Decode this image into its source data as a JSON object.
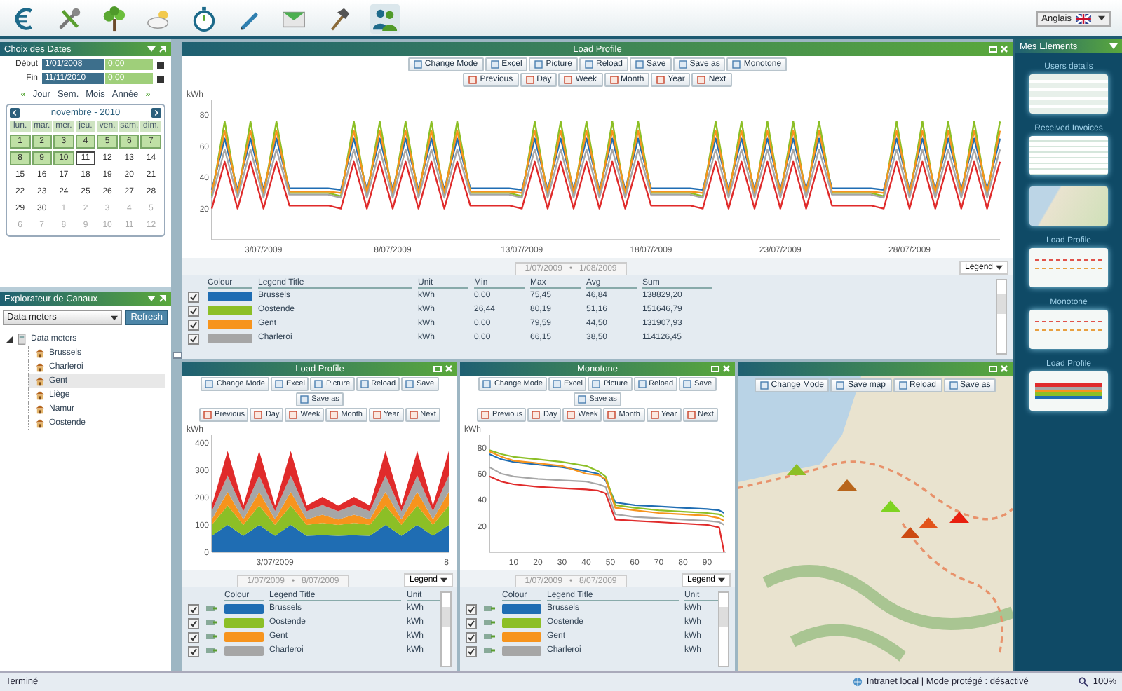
{
  "top_bar": {
    "nav_icons": [
      {
        "kind": "euro"
      },
      {
        "kind": "tools"
      },
      {
        "kind": "tree"
      },
      {
        "kind": "weather"
      },
      {
        "kind": "stopwatch"
      },
      {
        "kind": "pencil"
      },
      {
        "kind": "envelope"
      },
      {
        "kind": "hammer"
      },
      {
        "kind": "users"
      }
    ],
    "language": "Anglais"
  },
  "date_panel": {
    "title": "Choix des Dates",
    "start_label": "Début",
    "start_date": "1/01/2008",
    "start_time": "0:00",
    "end_label": "Fin",
    "end_date": "11/11/2010",
    "end_time": "0:00",
    "prev": "«",
    "next": "»",
    "modes": [
      "Jour",
      "Sem.",
      "Mois",
      "Année"
    ],
    "calendar": {
      "title": "novembre - 2010",
      "weekdays": [
        "lun.",
        "mar.",
        "mer.",
        "jeu.",
        "ven.",
        "sam.",
        "dim."
      ],
      "days": [
        {
          "label": "1",
          "selected": true,
          "today": false,
          "outside": false
        },
        {
          "label": "2",
          "selected": true,
          "today": false,
          "outside": false
        },
        {
          "label": "3",
          "selected": true,
          "today": false,
          "outside": false
        },
        {
          "label": "4",
          "selected": true,
          "today": false,
          "outside": false
        },
        {
          "label": "5",
          "selected": true,
          "today": false,
          "outside": false
        },
        {
          "label": "6",
          "selected": true,
          "today": false,
          "outside": false
        },
        {
          "label": "7",
          "selected": true,
          "today": false,
          "outside": false
        },
        {
          "label": "8",
          "selected": true,
          "today": false,
          "outside": false
        },
        {
          "label": "9",
          "selected": true,
          "today": false,
          "outside": false
        },
        {
          "label": "10",
          "selected": true,
          "today": false,
          "outside": false
        },
        {
          "label": "11",
          "selected": false,
          "today": true,
          "outside": false
        },
        {
          "label": "12",
          "selected": false,
          "today": false,
          "outside": false
        },
        {
          "label": "13",
          "selected": false,
          "today": false,
          "outside": false
        },
        {
          "label": "14",
          "selected": false,
          "today": false,
          "outside": false
        },
        {
          "label": "15",
          "selected": false,
          "today": false,
          "outside": false
        },
        {
          "label": "16",
          "selected": false,
          "today": false,
          "outside": false
        },
        {
          "label": "17",
          "selected": false,
          "today": false,
          "outside": false
        },
        {
          "label": "18",
          "selected": false,
          "today": false,
          "outside": false
        },
        {
          "label": "19",
          "selected": false,
          "today": false,
          "outside": false
        },
        {
          "label": "20",
          "selected": false,
          "today": false,
          "outside": false
        },
        {
          "label": "21",
          "selected": false,
          "today": false,
          "outside": false
        },
        {
          "label": "22",
          "selected": false,
          "today": false,
          "outside": false
        },
        {
          "label": "23",
          "selected": false,
          "today": false,
          "outside": false
        },
        {
          "label": "24",
          "selected": false,
          "today": false,
          "outside": false
        },
        {
          "label": "25",
          "selected": false,
          "today": false,
          "outside": false
        },
        {
          "label": "26",
          "selected": false,
          "today": false,
          "outside": false
        },
        {
          "label": "27",
          "selected": false,
          "today": false,
          "outside": false
        },
        {
          "label": "28",
          "selected": false,
          "today": false,
          "outside": false
        },
        {
          "label": "29",
          "selected": false,
          "today": false,
          "outside": false
        },
        {
          "label": "30",
          "selected": false,
          "today": false,
          "outside": false
        },
        {
          "label": "1",
          "selected": false,
          "today": false,
          "outside": true
        },
        {
          "label": "2",
          "selected": false,
          "today": false,
          "outside": true
        },
        {
          "label": "3",
          "selected": false,
          "today": false,
          "outside": true
        },
        {
          "label": "4",
          "selected": false,
          "today": false,
          "outside": true
        },
        {
          "label": "5",
          "selected": false,
          "today": false,
          "outside": true
        },
        {
          "label": "6",
          "selected": false,
          "today": false,
          "outside": true
        },
        {
          "label": "7",
          "selected": false,
          "today": false,
          "outside": true
        },
        {
          "label": "8",
          "selected": false,
          "today": false,
          "outside": true
        },
        {
          "label": "9",
          "selected": false,
          "today": false,
          "outside": true
        },
        {
          "label": "10",
          "selected": false,
          "today": false,
          "outside": true
        },
        {
          "label": "11",
          "selected": false,
          "today": false,
          "outside": true
        },
        {
          "label": "12",
          "selected": false,
          "today": false,
          "outside": true
        }
      ]
    }
  },
  "explorer": {
    "title": "Explorateur de Canaux",
    "source": "Data meters",
    "refresh": "Refresh",
    "tree": [
      {
        "label": "Data meters",
        "expanded": true,
        "selected": false,
        "children": [
          {
            "label": "Brussels",
            "selected": false
          },
          {
            "label": "Charleroi",
            "selected": false
          },
          {
            "label": "Gent",
            "selected": true
          },
          {
            "label": "Liège",
            "selected": false
          },
          {
            "label": "Namur",
            "selected": false
          },
          {
            "label": "Oostende",
            "selected": false
          }
        ]
      }
    ]
  },
  "main_panel": {
    "title": "Load Profile",
    "toolbar": [
      "Change Mode",
      "Excel",
      "Picture",
      "Reload",
      "Save",
      "Save as",
      "Monotone"
    ],
    "period_bar": [
      "Previous",
      "Day",
      "Week",
      "Month",
      "Year",
      "Next"
    ],
    "chart_data": {
      "type": "line",
      "ylabel": "kWh",
      "ylim": [
        0,
        90
      ],
      "categories": [
        null,
        null,
        null,
        null,
        "3/07/2009",
        null,
        null,
        null,
        null,
        null,
        null,
        null,
        null,
        null,
        "8/07/2009",
        null,
        null,
        null,
        null,
        null,
        null,
        null,
        null,
        null,
        "13/07/2009",
        null,
        null,
        null,
        null,
        null,
        null,
        null,
        null,
        null,
        "18/07/2009",
        null,
        null,
        null,
        null,
        null,
        null,
        null,
        null,
        null,
        "23/07/2009",
        null,
        null,
        null,
        null,
        null,
        null,
        null,
        null,
        null,
        "28/07/2009",
        null,
        null,
        null,
        null,
        null,
        null,
        null
      ],
      "yticks": [
        20,
        40,
        60,
        80
      ],
      "series": [
        {
          "color": "#1f6db3",
          "values": [
            32,
            65,
            32,
            65,
            32,
            65,
            33,
            33,
            33,
            33,
            32,
            65,
            32,
            65,
            32,
            65,
            32,
            65,
            32,
            65,
            33,
            33,
            33,
            33,
            32,
            65,
            32,
            65,
            32,
            65,
            32,
            65,
            32,
            65,
            33,
            33,
            33,
            33,
            32,
            65,
            32,
            65,
            32,
            65,
            32,
            65,
            32,
            65,
            33,
            33,
            33,
            33,
            32,
            65,
            32,
            65,
            32,
            65,
            32,
            65,
            32,
            65
          ]
        },
        {
          "color": "#8cbf26",
          "values": [
            28,
            76,
            28,
            76,
            28,
            76,
            30,
            30,
            30,
            30,
            28,
            76,
            28,
            76,
            28,
            76,
            28,
            76,
            28,
            76,
            30,
            30,
            30,
            30,
            28,
            76,
            28,
            76,
            28,
            76,
            28,
            76,
            28,
            76,
            30,
            30,
            30,
            30,
            28,
            76,
            28,
            76,
            28,
            76,
            28,
            76,
            28,
            76,
            30,
            30,
            30,
            30,
            28,
            76,
            28,
            76,
            28,
            76,
            28,
            76,
            28,
            76
          ]
        },
        {
          "color": "#f7941d",
          "values": [
            30,
            70,
            30,
            70,
            30,
            70,
            31,
            31,
            31,
            31,
            30,
            70,
            30,
            70,
            30,
            70,
            30,
            70,
            30,
            70,
            31,
            31,
            31,
            31,
            30,
            70,
            30,
            70,
            30,
            70,
            30,
            70,
            30,
            70,
            31,
            31,
            31,
            31,
            30,
            70,
            30,
            70,
            30,
            70,
            30,
            70,
            30,
            70,
            31,
            31,
            31,
            31,
            30,
            70,
            30,
            70,
            30,
            70,
            30,
            70,
            30,
            70
          ]
        },
        {
          "color": "#a6a6a6",
          "values": [
            27,
            58,
            27,
            58,
            27,
            58,
            29,
            29,
            29,
            29,
            27,
            58,
            27,
            58,
            27,
            58,
            27,
            58,
            27,
            58,
            29,
            29,
            29,
            29,
            27,
            58,
            27,
            58,
            27,
            58,
            27,
            58,
            27,
            58,
            29,
            29,
            29,
            29,
            27,
            58,
            27,
            58,
            27,
            58,
            27,
            58,
            27,
            58,
            29,
            29,
            29,
            29,
            27,
            58,
            27,
            58,
            27,
            58,
            27,
            58,
            27,
            58
          ]
        },
        {
          "color": "#e02b2b",
          "values": [
            20,
            50,
            20,
            50,
            20,
            50,
            22,
            22,
            22,
            22,
            20,
            50,
            20,
            50,
            20,
            50,
            20,
            50,
            20,
            50,
            22,
            22,
            22,
            22,
            20,
            50,
            20,
            50,
            20,
            50,
            20,
            50,
            20,
            50,
            22,
            22,
            22,
            22,
            20,
            50,
            20,
            50,
            20,
            50,
            20,
            50,
            20,
            50,
            22,
            22,
            22,
            22,
            20,
            50,
            20,
            50,
            20,
            50,
            20,
            50,
            20,
            50
          ]
        }
      ]
    },
    "range_start": "1/07/2009",
    "range_sep": "•",
    "range_end": "1/08/2009",
    "legend_button": "Legend",
    "table": {
      "colour_column": "Colour",
      "columns": [
        "Legend Title",
        "Unit",
        "Min",
        "Max",
        "Avg",
        "Sum"
      ],
      "rows": [
        {
          "checked": true,
          "color": "#1f6db3",
          "cells": [
            "Brussels",
            "kWh",
            "0,00",
            "75,45",
            "46,84",
            "138829,20"
          ]
        },
        {
          "checked": true,
          "color": "#8cbf26",
          "cells": [
            "Oostende",
            "kWh",
            "26,44",
            "80,19",
            "51,16",
            "151646,79"
          ]
        },
        {
          "checked": true,
          "color": "#f7941d",
          "cells": [
            "Gent",
            "kWh",
            "0,00",
            "79,59",
            "44,50",
            "131907,93"
          ]
        },
        {
          "checked": true,
          "color": "#a6a6a6",
          "cells": [
            "Charleroi",
            "kWh",
            "0,00",
            "66,15",
            "38,50",
            "114126,45"
          ]
        }
      ]
    }
  },
  "lower_panels": [
    {
      "title": "Load Profile",
      "toolbar": [
        "Change Mode",
        "Excel",
        "Picture",
        "Reload",
        "Save",
        "Save as"
      ],
      "period_bar": [
        "Previous",
        "Day",
        "Week",
        "Month",
        "Year",
        "Next"
      ],
      "chart_data": {
        "type": "area",
        "stacked": true,
        "ylabel": "kWh",
        "ylim": [
          0,
          430
        ],
        "categories": [
          null,
          null,
          null,
          null,
          "3/07/2009",
          null,
          null,
          null,
          null,
          null,
          null,
          null,
          null,
          null,
          null,
          "8"
        ],
        "yticks": [
          0,
          100,
          200,
          300,
          400
        ],
        "series": [
          {
            "color": "#1f6db3",
            "values": [
              60,
              100,
              60,
              100,
              60,
              100,
              60,
              62,
              60,
              62,
              60,
              100,
              60,
              100,
              60,
              100
            ]
          },
          {
            "color": "#8cbf26",
            "values": [
              40,
              70,
              40,
              70,
              40,
              70,
              40,
              45,
              40,
              45,
              40,
              70,
              40,
              70,
              40,
              70
            ]
          },
          {
            "color": "#f7941d",
            "values": [
              20,
              50,
              20,
              50,
              20,
              50,
              20,
              30,
              20,
              30,
              20,
              50,
              20,
              50,
              20,
              50
            ]
          },
          {
            "color": "#a6a6a6",
            "values": [
              30,
              60,
              30,
              60,
              30,
              60,
              30,
              35,
              30,
              35,
              30,
              60,
              30,
              60,
              30,
              60
            ]
          },
          {
            "color": "#e02b2b",
            "values": [
              20,
              90,
              20,
              90,
              20,
              90,
              20,
              30,
              20,
              30,
              20,
              90,
              20,
              90,
              20,
              90
            ]
          }
        ]
      },
      "range_start": "1/07/2009",
      "range_sep": "•",
      "range_end": "8/07/2009",
      "legend_button": "Legend",
      "table": {
        "colour_column": "Colour",
        "columns": [
          "Legend Title",
          "Unit"
        ],
        "rows": [
          {
            "checked": true,
            "color": "#1f6db3",
            "cells": [
              "Brussels",
              "kWh"
            ]
          },
          {
            "checked": true,
            "color": "#8cbf26",
            "cells": [
              "Oostende",
              "kWh"
            ]
          },
          {
            "checked": true,
            "color": "#f7941d",
            "cells": [
              "Gent",
              "kWh"
            ]
          },
          {
            "checked": true,
            "color": "#a6a6a6",
            "cells": [
              "Charleroi",
              "kWh"
            ]
          }
        ]
      }
    },
    {
      "title": "Monotone",
      "toolbar": [
        "Change Mode",
        "Excel",
        "Picture",
        "Reload",
        "Save",
        "Save as"
      ],
      "period_bar": [
        "Previous",
        "Day",
        "Week",
        "Month",
        "Year",
        "Next"
      ],
      "chart_data": {
        "type": "line",
        "ylabel": "kWh",
        "xlim": [
          0,
          98
        ],
        "ylim": [
          0,
          90
        ],
        "x": [
          0,
          5,
          10,
          20,
          30,
          40,
          45,
          48,
          52,
          60,
          70,
          80,
          90,
          95,
          97
        ],
        "xticks": [
          10,
          20,
          30,
          40,
          50,
          60,
          70,
          80,
          90
        ],
        "yticks": [
          20,
          40,
          60,
          80
        ],
        "series": [
          {
            "color": "#1f6db3",
            "values": [
              75,
              71,
              69,
              67,
              65,
              62,
              60,
              55,
              38,
              36,
              35,
              34,
              33,
              32,
              30
            ]
          },
          {
            "color": "#8cbf26",
            "values": [
              78,
              75,
              73,
              71,
              69,
              66,
              62,
              58,
              36,
              34,
              32,
              31,
              30,
              29,
              27
            ]
          },
          {
            "color": "#f7941d",
            "values": [
              77,
              73,
              70,
              68,
              66,
              60,
              59,
              56,
              34,
              32,
              30,
              29,
              28,
              26,
              24
            ]
          },
          {
            "color": "#a6a6a6",
            "values": [
              65,
              60,
              58,
              56,
              55,
              54,
              52,
              50,
              29,
              27,
              26,
              25,
              24,
              23,
              21
            ]
          },
          {
            "color": "#e02b2b",
            "values": [
              58,
              54,
              52,
              50,
              49,
              48,
              47,
              45,
              25,
              24,
              23,
              22,
              21,
              19,
              0
            ]
          }
        ]
      },
      "range_start": "1/07/2009",
      "range_sep": "•",
      "range_end": "8/07/2009",
      "legend_button": "Legend",
      "table": {
        "colour_column": "Colour",
        "columns": [
          "Legend Title",
          "Unit"
        ],
        "rows": [
          {
            "checked": true,
            "color": "#1f6db3",
            "cells": [
              "Brussels",
              "kWh"
            ]
          },
          {
            "checked": true,
            "color": "#8cbf26",
            "cells": [
              "Oostende",
              "kWh"
            ]
          },
          {
            "checked": true,
            "color": "#f7941d",
            "cells": [
              "Gent",
              "kWh"
            ]
          },
          {
            "checked": true,
            "color": "#a6a6a6",
            "cells": [
              "Charleroi",
              "kWh"
            ]
          }
        ]
      }
    }
  ],
  "map_panel": {
    "toolbar": [
      "Change Mode",
      "Save map",
      "Reload",
      "Save as"
    ],
    "markers": [
      {
        "color": "#8cbf26"
      },
      {
        "color": "#b8651b"
      },
      {
        "color": "#7ed321"
      },
      {
        "color": "#e2541b"
      },
      {
        "color": "#cc4a12"
      },
      {
        "color": "#e8200f"
      }
    ]
  },
  "side_panel": {
    "title": "Mes Elements",
    "items": [
      {
        "kind": "table",
        "title": "Users details"
      },
      {
        "kind": "invoice",
        "title": "Received Invoices"
      },
      {
        "kind": "map"
      },
      {
        "kind": "line",
        "title": "Load Profile"
      },
      {
        "kind": "monotone",
        "title": "Monotone"
      },
      {
        "kind": "area",
        "title": "Load Profile"
      }
    ]
  },
  "status_bar": {
    "left": "Terminé",
    "zone": "Intranet local | Mode protégé : désactivé",
    "zoom": "100%"
  }
}
